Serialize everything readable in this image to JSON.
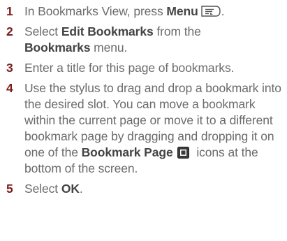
{
  "steps": [
    {
      "num": "1",
      "parts": {
        "a": "In Bookmarks View, press ",
        "b": "Menu",
        "c": "."
      }
    },
    {
      "num": "2",
      "parts": {
        "a": "Select ",
        "b": "Edit Bookmarks",
        "c": " from the ",
        "d": "Bookmarks",
        "e": " menu."
      }
    },
    {
      "num": "3",
      "parts": {
        "a": "Enter a title for this page of bookmarks."
      }
    },
    {
      "num": "4",
      "parts": {
        "a": "Use the stylus to drag and drop a bookmark into the desired slot. You can move a bookmark within the current page or move it to a different bookmark page by dragging and dropping it on one of the ",
        "b": "Bookmark Page",
        "c": " icons at the bottom of the screen."
      }
    },
    {
      "num": "5",
      "parts": {
        "a": "Select ",
        "b": "OK",
        "c": "."
      }
    }
  ],
  "icons": {
    "menu_key": "menu-key-icon",
    "bookmark_page": "bookmark-page-icon"
  },
  "colors": {
    "step_number": "#7a1c1c",
    "body_text": "#6b6b6b",
    "bold_text": "#444444"
  }
}
